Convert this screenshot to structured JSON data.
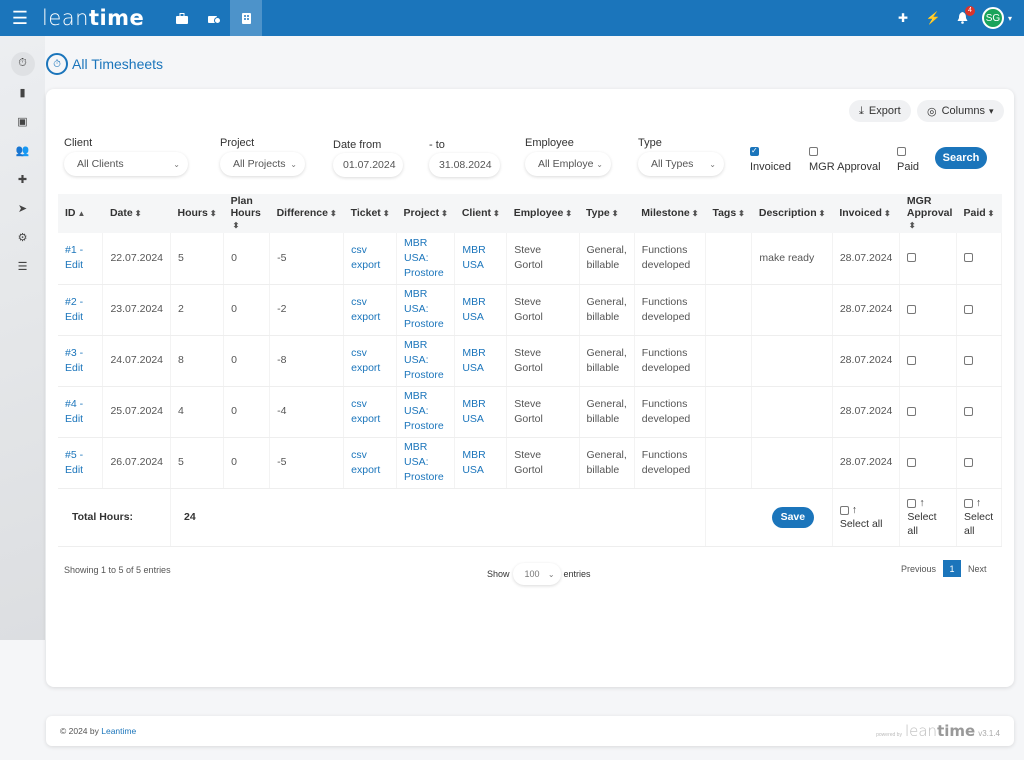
{
  "header": {
    "logo_light": "lean",
    "logo_bold": "time",
    "nav_icons": [
      "briefcase-icon",
      "timesheet-icon",
      "building-icon"
    ],
    "notification_count": "4",
    "avatar_initials": "SG",
    "icons": {
      "menu": "☰",
      "briefcase": "💼",
      "timesheet": "⏱",
      "building": "▦",
      "puzzle": "✚",
      "bolt": "⚡",
      "bell": "🔔",
      "caret": "▾"
    }
  },
  "sidebar": {
    "items": [
      {
        "name": "timesheets",
        "glyph": "⏱"
      },
      {
        "name": "projects",
        "glyph": "▮"
      },
      {
        "name": "clients",
        "glyph": "▣"
      },
      {
        "name": "users",
        "glyph": "👥"
      },
      {
        "name": "plugins",
        "glyph": "✚"
      },
      {
        "name": "share",
        "glyph": "➤"
      },
      {
        "name": "settings",
        "glyph": "⚙"
      },
      {
        "name": "list",
        "glyph": "☰"
      }
    ]
  },
  "page": {
    "title": "All Timesheets",
    "title_icon": "⏱"
  },
  "toolbar": {
    "export_label": "Export",
    "export_icon": "⤓",
    "columns_label": "Columns",
    "columns_icon": "◎",
    "columns_caret": "▾"
  },
  "filters": {
    "client_label": "Client",
    "client_value": "All Clients",
    "project_label": "Project",
    "project_value": "All Projects",
    "date_from_label": "Date from",
    "date_from_value": "01.07.2024",
    "date_to_label": "- to",
    "date_to_value": "31.08.2024",
    "employee_label": "Employee",
    "employee_value": "All Employe",
    "type_label": "Type",
    "type_value": "All Types",
    "invoiced_label": "Invoiced",
    "invoiced_checked": true,
    "mgr_label": "MGR Approval",
    "mgr_checked": false,
    "paid_label": "Paid",
    "paid_checked": false,
    "search_label": "Search",
    "chevron": "⌄"
  },
  "table": {
    "sort_active": "▲",
    "sort_icon": "⬍",
    "columns": [
      {
        "label": "ID"
      },
      {
        "label": "Date"
      },
      {
        "label": "Hours"
      },
      {
        "label": "Plan Hours"
      },
      {
        "label": "Difference"
      },
      {
        "label": "Ticket"
      },
      {
        "label": "Project"
      },
      {
        "label": "Client"
      },
      {
        "label": "Employee"
      },
      {
        "label": "Type"
      },
      {
        "label": "Milestone"
      },
      {
        "label": "Tags"
      },
      {
        "label": "Description"
      },
      {
        "label": "Invoiced"
      },
      {
        "label": "MGR Approval"
      },
      {
        "label": "Paid"
      }
    ],
    "rows": [
      {
        "id": "#1 - Edit",
        "date": "22.07.2024",
        "hours": "5",
        "plan": "0",
        "diff": "-5",
        "ticket": "csv export",
        "project": "MBR USA: Prostore",
        "client": "MBR USA",
        "employee": "Steve Gortol",
        "type": "General, billable",
        "milestone": "Functions developed",
        "tags": "",
        "description": "make ready",
        "invoiced": "28.07.2024"
      },
      {
        "id": "#2 - Edit",
        "date": "23.07.2024",
        "hours": "2",
        "plan": "0",
        "diff": "-2",
        "ticket": "csv export",
        "project": "MBR USA: Prostore",
        "client": "MBR USA",
        "employee": "Steve Gortol",
        "type": "General, billable",
        "milestone": "Functions developed",
        "tags": "",
        "description": "",
        "invoiced": "28.07.2024"
      },
      {
        "id": "#3 - Edit",
        "date": "24.07.2024",
        "hours": "8",
        "plan": "0",
        "diff": "-8",
        "ticket": "csv export",
        "project": "MBR USA: Prostore",
        "client": "MBR USA",
        "employee": "Steve Gortol",
        "type": "General, billable",
        "milestone": "Functions developed",
        "tags": "",
        "description": "",
        "invoiced": "28.07.2024"
      },
      {
        "id": "#4 - Edit",
        "date": "25.07.2024",
        "hours": "4",
        "plan": "0",
        "diff": "-4",
        "ticket": "csv export",
        "project": "MBR USA: Prostore",
        "client": "MBR USA",
        "employee": "Steve Gortol",
        "type": "General, billable",
        "milestone": "Functions developed",
        "tags": "",
        "description": "",
        "invoiced": "28.07.2024"
      },
      {
        "id": "#5 - Edit",
        "date": "26.07.2024",
        "hours": "5",
        "plan": "0",
        "diff": "-5",
        "ticket": "csv export",
        "project": "MBR USA: Prostore",
        "client": "MBR USA",
        "employee": "Steve Gortol",
        "type": "General, billable",
        "milestone": "Functions developed",
        "tags": "",
        "description": "",
        "invoiced": "28.07.2024"
      }
    ],
    "footer": {
      "total_label": "Total Hours:",
      "total_value": "24",
      "save_label": "Save",
      "select_all_label": "Select all",
      "select_all_arrow": "↑"
    }
  },
  "pagination": {
    "showing_text": "Showing 1 to 5 of 5 entries",
    "show_label": "Show",
    "length_value": "100",
    "entries_label": "entries",
    "previous_label": "Previous",
    "current_page": "1",
    "next_label": "Next"
  },
  "footer": {
    "copyright": "© 2024 by",
    "link": "Leantime",
    "powered_by": "powered by",
    "logo_light": "lean",
    "logo_bold": "time",
    "version": "v3.1.4"
  },
  "colors": {
    "primary": "#1b75bb",
    "avatar": "#1aa35b",
    "badge": "#d9342b"
  }
}
